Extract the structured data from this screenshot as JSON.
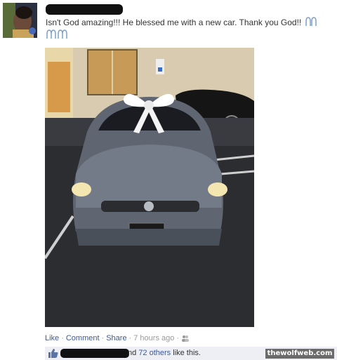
{
  "post": {
    "text": "Isn't God amazing!!! He blessed me with a new car. Thank you God!!",
    "emoji_icon": "praying-hands-icon"
  },
  "actions": {
    "like": "Like",
    "comment": "Comment",
    "share": "Share",
    "time": "7 hours ago",
    "sep": "·",
    "audience_icon": "friends-icon"
  },
  "likes": {
    "prefix": "nd",
    "others": "72 others",
    "suffix": "like this."
  },
  "watermark": "thewolfweb.com",
  "colors": {
    "link": "#3b5998",
    "likes_bg": "#edeff4",
    "car": "#6a7180"
  }
}
